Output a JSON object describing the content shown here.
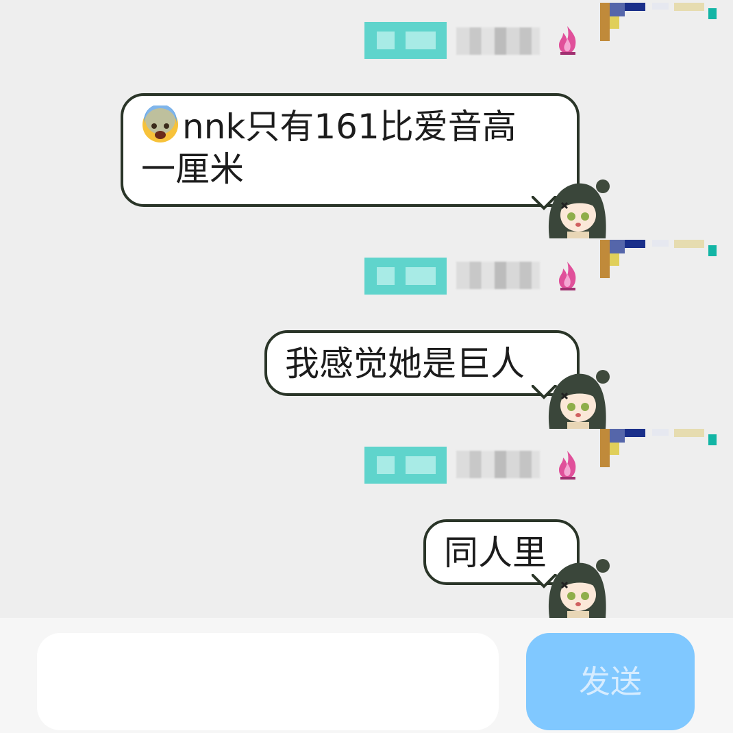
{
  "messages": [
    {
      "text_line1": "nnk只有161比爱音高",
      "text_line2": "一厘米",
      "emoji": "anxious-face-with-sweat"
    },
    {
      "text": "我感觉她是巨人"
    },
    {
      "text": "同人里"
    }
  ],
  "composer": {
    "input_value": "",
    "send_label": "发送"
  },
  "colors": {
    "background": "#eeeeee",
    "bubble_border": "#2a3528",
    "send_button": "#80c8ff",
    "name_tag": "#5fd4cc"
  },
  "icons": [
    "fire-icon",
    "avatar-icon",
    "anxious-face-icon"
  ]
}
